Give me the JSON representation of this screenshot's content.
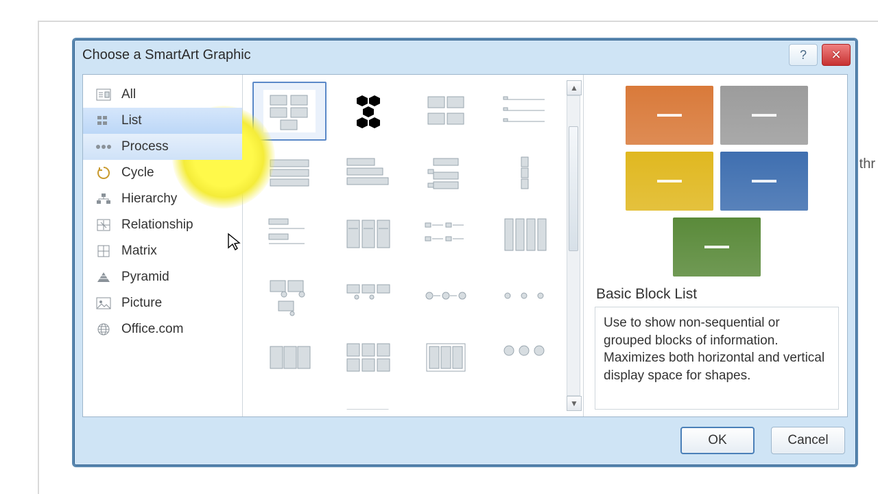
{
  "background_text": "thr",
  "dialog": {
    "title": "Choose a SmartArt Graphic",
    "help_tooltip": "Help",
    "close_tooltip": "Close"
  },
  "categories": [
    {
      "id": "all",
      "label": "All",
      "icon": "all-icon"
    },
    {
      "id": "list",
      "label": "List",
      "icon": "list-icon",
      "selected": true
    },
    {
      "id": "process",
      "label": "Process",
      "icon": "process-icon",
      "hover": true
    },
    {
      "id": "cycle",
      "label": "Cycle",
      "icon": "cycle-icon"
    },
    {
      "id": "hierarchy",
      "label": "Hierarchy",
      "icon": "hierarchy-icon"
    },
    {
      "id": "relationship",
      "label": "Relationship",
      "icon": "relationship-icon"
    },
    {
      "id": "matrix",
      "label": "Matrix",
      "icon": "matrix-icon"
    },
    {
      "id": "pyramid",
      "label": "Pyramid",
      "icon": "pyramid-icon"
    },
    {
      "id": "picture",
      "label": "Picture",
      "icon": "picture-icon"
    },
    {
      "id": "officecom",
      "label": "Office.com",
      "icon": "globe-icon"
    }
  ],
  "gallery": {
    "selected_index": 0,
    "thumbs": 24
  },
  "preview": {
    "title": "Basic Block List",
    "description": "Use to show non-sequential or grouped blocks of information. Maximizes both horizontal and vertical display space for shapes.",
    "blocks": [
      {
        "color": "#d97a3a"
      },
      {
        "color": "#9c9c9c"
      },
      {
        "color": "#e0b820"
      },
      {
        "color": "#3f6fb0"
      },
      {
        "color": "#5a8a3a"
      }
    ]
  },
  "buttons": {
    "ok": "OK",
    "cancel": "Cancel"
  }
}
